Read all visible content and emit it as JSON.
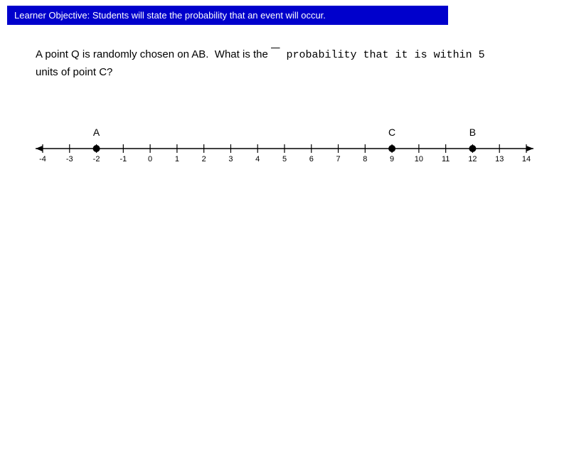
{
  "header": {
    "text": "Learner Objective:  Students will state the probability that an event will occur."
  },
  "question": {
    "part1": "A point Q is randomly chosen on AB.  What is the",
    "part2": "probability that it is within 5",
    "part3": "units of point C?"
  },
  "numberLine": {
    "min": -4,
    "max": 14,
    "points": [
      {
        "value": -2,
        "label": "A"
      },
      {
        "value": 9,
        "label": "C"
      },
      {
        "value": 12,
        "label": "B"
      }
    ]
  }
}
